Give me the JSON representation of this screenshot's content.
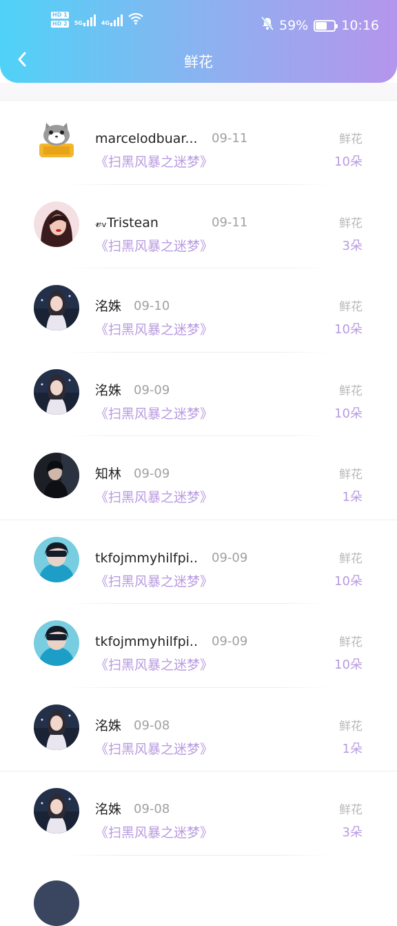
{
  "status_bar": {
    "sim1": "HD 1",
    "sim2": "HD 2",
    "net1": "5G",
    "net2": "4G",
    "battery_percent": "59%",
    "battery_level": 0.59,
    "time": "10:16",
    "icons": [
      "wifi-icon",
      "bell-muted-icon",
      "battery-icon"
    ]
  },
  "header": {
    "title": "鲜花",
    "back_icon": "chevron-left-icon",
    "colors": {
      "gradient_start": "#4fd2f7",
      "gradient_end": "#b595ec"
    }
  },
  "accent_color": "#b89ae0",
  "items": [
    {
      "username": "marcelodbuar...",
      "date": "09-11",
      "work": "《扫黑风暴之迷梦》",
      "gift": "鲜花",
      "count": "10朵",
      "avatar": "cartoon-cat"
    },
    {
      "username": "𝓋ᵥTristean",
      "date": "09-11",
      "work": "《扫黑风暴之迷梦》",
      "gift": "鲜花",
      "count": "3朵",
      "avatar": "woman-pink"
    },
    {
      "username": "洺姝",
      "date": "09-10",
      "work": "《扫黑风暴之迷梦》",
      "gift": "鲜花",
      "count": "10朵",
      "avatar": "girl-night"
    },
    {
      "username": "洺姝",
      "date": "09-09",
      "work": "《扫黑风暴之迷梦》",
      "gift": "鲜花",
      "count": "10朵",
      "avatar": "girl-night"
    },
    {
      "username": "知林",
      "date": "09-09",
      "work": "《扫黑风暴之迷梦》",
      "gift": "鲜花",
      "count": "1朵",
      "avatar": "man-dark"
    },
    {
      "username": "tkfojmmyhilfpi...",
      "date": "09-09",
      "work": "《扫黑风暴之迷梦》",
      "gift": "鲜花",
      "count": "10朵",
      "avatar": "boy-blue"
    },
    {
      "username": "tkfojmmyhilfpi...",
      "date": "09-09",
      "work": "《扫黑风暴之迷梦》",
      "gift": "鲜花",
      "count": "10朵",
      "avatar": "boy-blue"
    },
    {
      "username": "洺姝",
      "date": "09-08",
      "work": "《扫黑风暴之迷梦》",
      "gift": "鲜花",
      "count": "1朵",
      "avatar": "girl-night"
    },
    {
      "username": "洺姝",
      "date": "09-08",
      "work": "《扫黑风暴之迷梦》",
      "gift": "鲜花",
      "count": "3朵",
      "avatar": "girl-night"
    }
  ]
}
